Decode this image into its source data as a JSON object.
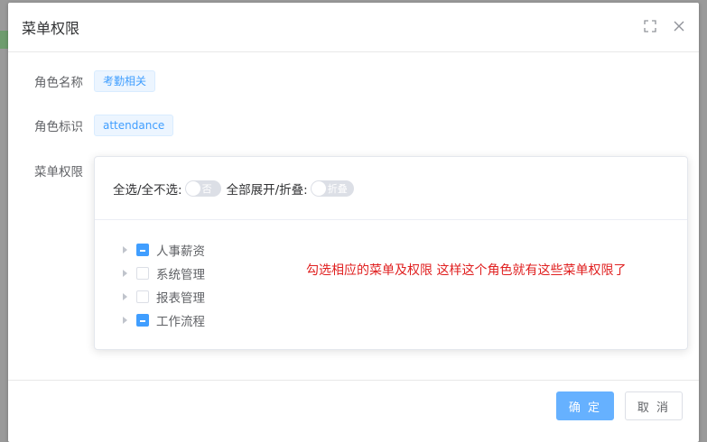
{
  "dialog": {
    "title": "菜单权限"
  },
  "form": {
    "role_name_label": "角色名称",
    "role_name_value": "考勤相关",
    "role_key_label": "角色标识",
    "role_key_value": "attendance",
    "menu_perm_label": "菜单权限"
  },
  "toolbar": {
    "select_all_label": "全选/全不选:",
    "select_all_switch_text": "否",
    "expand_label": "全部展开/折叠:",
    "expand_switch_text": "折叠"
  },
  "tree": {
    "items": [
      {
        "label": "人事薪资",
        "check": "indeterminate"
      },
      {
        "label": "系统管理",
        "check": "unchecked"
      },
      {
        "label": "报表管理",
        "check": "unchecked"
      },
      {
        "label": "工作流程",
        "check": "indeterminate"
      }
    ]
  },
  "annotation": "勾选相应的菜单及权限 这样这个角色就有这些菜单权限了",
  "footer": {
    "confirm_label": "确 定",
    "cancel_label": "取 消"
  },
  "colors": {
    "primary": "#409eff",
    "primary_light": "#66b1ff",
    "annotation": "#e02020"
  }
}
